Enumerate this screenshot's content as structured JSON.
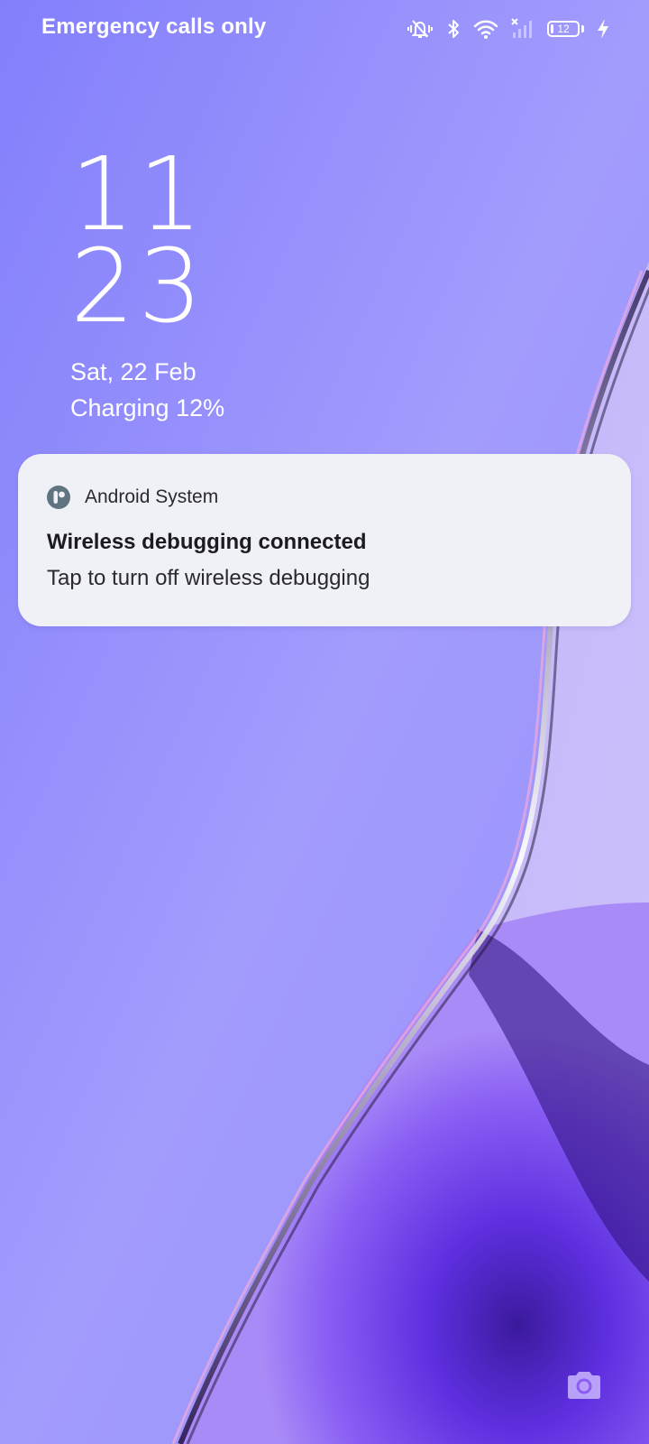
{
  "status_bar": {
    "carrier": "Emergency calls only",
    "battery_level": "12",
    "battery_fraction": 0.12,
    "icons": [
      "vibrate-mute-icon",
      "bluetooth-icon",
      "wifi-icon",
      "no-signal-icon",
      "battery-icon",
      "charging-bolt-icon"
    ]
  },
  "lockscreen": {
    "clock_hour": "11",
    "clock_minute": "23",
    "date": "Sat, 22 Feb",
    "charging_status": "Charging 12%"
  },
  "notification": {
    "app_name": "Android System",
    "app_icon": "android-system-icon",
    "title": "Wireless debugging connected",
    "text": "Tap to turn off wireless debugging"
  },
  "shortcuts": {
    "camera_icon": "camera-icon"
  },
  "colors": {
    "wallpaper_base": "#9893fc",
    "wallpaper_accent": "#6a35e8",
    "notification_bg": "#f0f1f6",
    "app_icon": "#5f7480"
  }
}
